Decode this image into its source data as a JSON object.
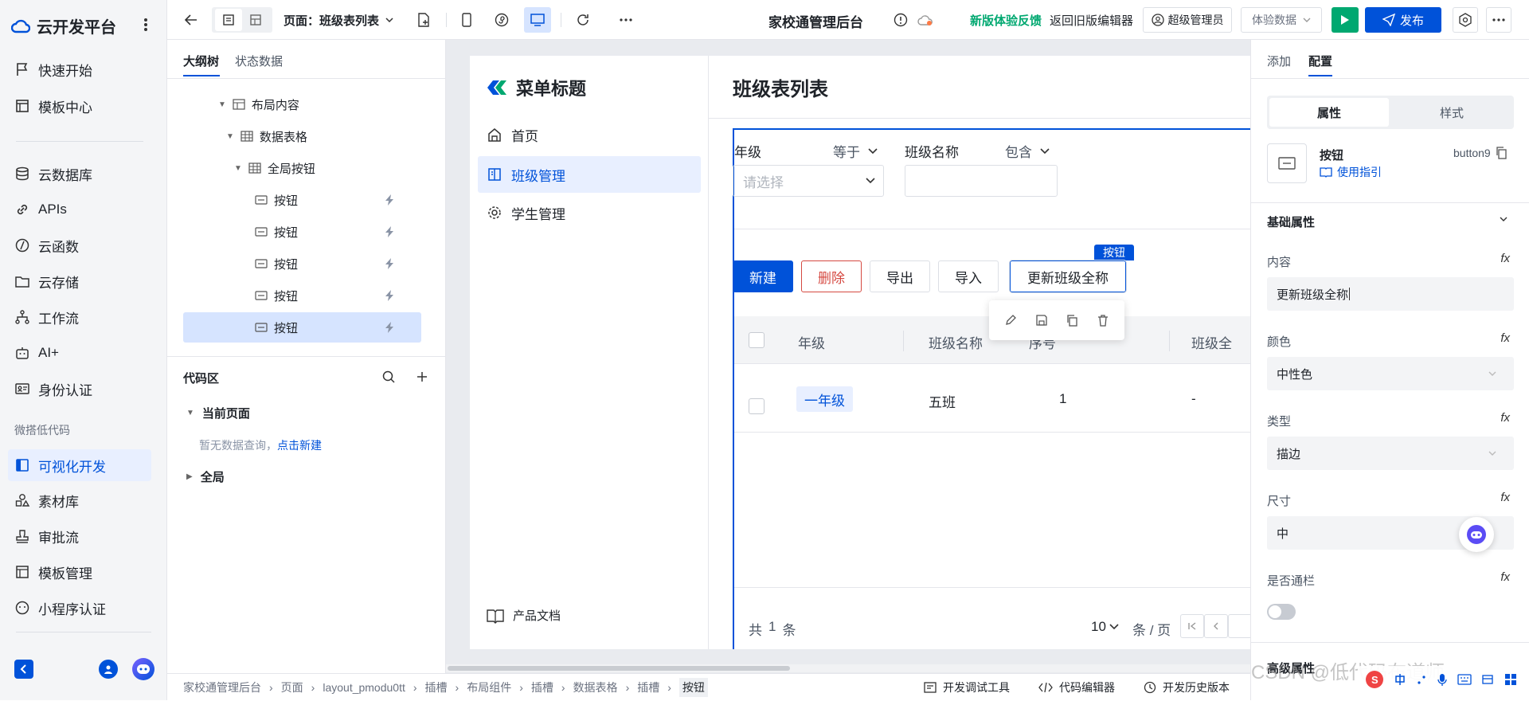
{
  "platform": {
    "title": "云开发平台"
  },
  "leftnav": {
    "items": [
      {
        "label": "快速开始"
      },
      {
        "label": "模板中心"
      },
      {
        "label": "云数据库"
      },
      {
        "label": "APIs"
      },
      {
        "label": "云函数"
      },
      {
        "label": "云存储"
      },
      {
        "label": "工作流"
      },
      {
        "label": "AI+"
      },
      {
        "label": "身份认证"
      }
    ],
    "section_label": "微搭低代码",
    "items2": [
      {
        "label": "可视化开发"
      },
      {
        "label": "素材库"
      },
      {
        "label": "审批流"
      },
      {
        "label": "模板管理"
      },
      {
        "label": "小程序认证"
      }
    ]
  },
  "toolbar": {
    "page_label": "页面：班级表列表",
    "app_title": "家校通管理后台",
    "feedback": "新版体验反馈",
    "back_old": "返回旧版编辑器",
    "admin": "超级管理员",
    "exp_data": "体验数据",
    "publish": "发布"
  },
  "outline": {
    "tabs": [
      "大纲树",
      "状态数据"
    ],
    "nodes": [
      {
        "label": "布局内容"
      },
      {
        "label": "数据表格"
      },
      {
        "label": "全局按钮"
      },
      {
        "label": "按钮"
      },
      {
        "label": "按钮"
      },
      {
        "label": "按钮"
      },
      {
        "label": "按钮"
      },
      {
        "label": "按钮"
      }
    ],
    "code_title": "代码区",
    "current_page": "当前页面",
    "empty_text": "暂无数据查询，",
    "empty_link": "点击新建",
    "global": "全局"
  },
  "app": {
    "menu_title": "菜单标题",
    "menu": [
      {
        "label": "首页"
      },
      {
        "label": "班级管理"
      },
      {
        "label": "学生管理"
      }
    ],
    "docs": "产品文档",
    "page_title": "班级表列表",
    "filters": {
      "grade_label": "年级",
      "grade_op": "等于",
      "grade_placeholder": "请选择",
      "name_label": "班级名称",
      "name_op": "包含"
    },
    "buttons": {
      "new": "新建",
      "delete": "删除",
      "export": "导出",
      "import": "导入",
      "update": "更新班级全称",
      "tag": "按钮"
    },
    "table": {
      "headers": [
        "年级",
        "班级名称",
        "序号",
        "班级全"
      ],
      "row": {
        "grade": "一年级",
        "name": "五班",
        "index": "1",
        "full": "-"
      }
    },
    "pagination": {
      "total_prefix": "共",
      "total": "1",
      "total_suffix": "条",
      "page_size": "10",
      "per_page": "条 / 页"
    }
  },
  "rightpanel": {
    "tabs": [
      "添加",
      "配置"
    ],
    "subtabs": [
      "属性",
      "样式"
    ],
    "component_name": "按钮",
    "component_id": "button9",
    "guide": "使用指引",
    "section_basic": "基础属性",
    "props": [
      {
        "label": "内容",
        "value": "更新班级全称"
      },
      {
        "label": "颜色",
        "value": "中性色"
      },
      {
        "label": "类型",
        "value": "描边"
      },
      {
        "label": "尺寸",
        "value": "中"
      },
      {
        "label": "是否通栏",
        "value": ""
      }
    ],
    "section_adv": "高级属性",
    "fx": "fx"
  },
  "bottombar": {
    "crumbs": [
      "家校通管理后台",
      "页面",
      "layout_pmodu0tt",
      "插槽",
      "布局组件",
      "插槽",
      "数据表格",
      "插槽",
      "按钮"
    ],
    "tools": [
      "开发调试工具",
      "代码编辑器",
      "开发历史版本"
    ]
  },
  "watermark": "CSDN @低代码布道师",
  "colors": {
    "primary": "#0052d9",
    "green": "#00a870",
    "danger": "#d54941"
  }
}
